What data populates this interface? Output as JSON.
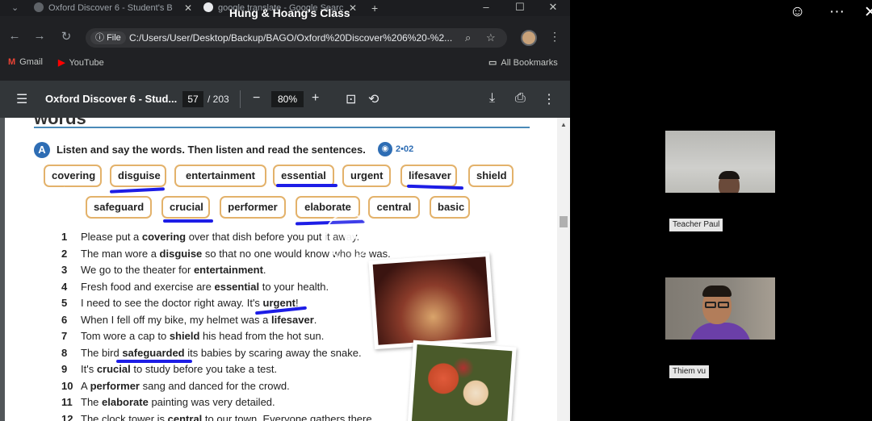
{
  "meeting": {
    "title": "Hung & Hoang's Class"
  },
  "browser": {
    "tabs": [
      {
        "label": "Oxford Discover 6 - Student's B"
      },
      {
        "label": "google translate - Google Searc"
      }
    ],
    "new_tab": "+",
    "url": "C:/Users/User/Desktop/Backup/BAGO/Oxford%20Discover%206%20-%2...",
    "file_chip": "File",
    "bookmarks": [
      {
        "label": "Gmail"
      },
      {
        "label": "YouTube"
      }
    ],
    "all_bookmarks": "All Bookmarks"
  },
  "pdf": {
    "title": "Oxford Discover 6 - Stud...",
    "page_current": "57",
    "page_total": "/ 203",
    "zoom": "80%"
  },
  "page": {
    "section_heading": "words",
    "badge": "A",
    "instruction": "Listen and say the words. Then listen and read the sentences.",
    "track": "2•02",
    "words": [
      "covering",
      "disguise",
      "entertainment",
      "essential",
      "urgent",
      "lifesaver",
      "shield",
      "safeguard",
      "crucial",
      "performer",
      "elaborate",
      "central",
      "basic"
    ],
    "sentences": [
      {
        "num": "1",
        "pre": "Please put a ",
        "word": "covering",
        "post": " over that dish before you put it away."
      },
      {
        "num": "2",
        "pre": "The man wore a ",
        "word": "disguise",
        "post": " so that no one would know who he was."
      },
      {
        "num": "3",
        "pre": "We go to the theater for ",
        "word": "entertainment",
        "post": "."
      },
      {
        "num": "4",
        "pre": "Fresh food and exercise are ",
        "word": "essential",
        "post": " to your health."
      },
      {
        "num": "5",
        "pre": "I need to see the doctor right away. It's ",
        "word": "urgent",
        "post": "!"
      },
      {
        "num": "6",
        "pre": "When I fell off my bike, my helmet was a ",
        "word": "lifesaver",
        "post": "."
      },
      {
        "num": "7",
        "pre": "Tom wore a cap to ",
        "word": "shield",
        "post": " his head from the hot sun."
      },
      {
        "num": "8",
        "pre": "The bird ",
        "word": "safeguarded",
        "post": " its babies by scaring away the snake."
      },
      {
        "num": "9",
        "pre": "It's ",
        "word": "crucial",
        "post": " to study before you take a test."
      },
      {
        "num": "10",
        "pre": "A ",
        "word": "performer",
        "post": " sang and danced for the crowd."
      },
      {
        "num": "11",
        "pre": "The ",
        "word": "elaborate",
        "post": " painting was very detailed."
      },
      {
        "num": "12",
        "pre": "The clock tower is ",
        "word": "central",
        "post": " to our town. Everyone gathers there."
      }
    ]
  },
  "participants": [
    {
      "name": "Teacher Paul"
    },
    {
      "name": "Thiem vu"
    }
  ],
  "colors": {
    "annotation_pen": "#1d1de6",
    "chip_border": "#e3b26b",
    "accent_blue": "#2e6db4"
  }
}
